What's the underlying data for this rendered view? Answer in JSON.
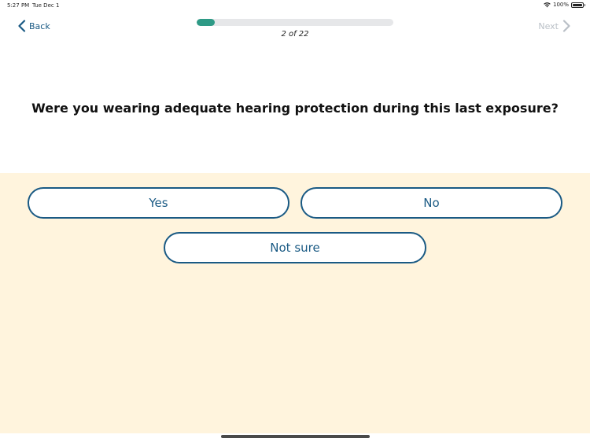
{
  "status_bar": {
    "time": "5:27 PM",
    "date": "Tue Dec 1",
    "battery": "100%"
  },
  "nav": {
    "back_label": "Back",
    "next_label": "Next"
  },
  "progress": {
    "label": "2 of 22",
    "fraction": 0.09
  },
  "question": "Were you wearing adequate hearing protection during this last exposure?",
  "answers": [
    {
      "label": "Yes"
    },
    {
      "label": "No"
    },
    {
      "label": "Not sure"
    }
  ],
  "colors": {
    "accent": "#1a5a84",
    "progress_fill": "#2e9a86",
    "panel_background": "#fff4dd",
    "disabled_text": "#b9bfc6"
  },
  "icons": {
    "back": "chevron-left-icon",
    "next": "chevron-right-icon",
    "wifi": "wifi-icon",
    "battery": "battery-icon"
  }
}
